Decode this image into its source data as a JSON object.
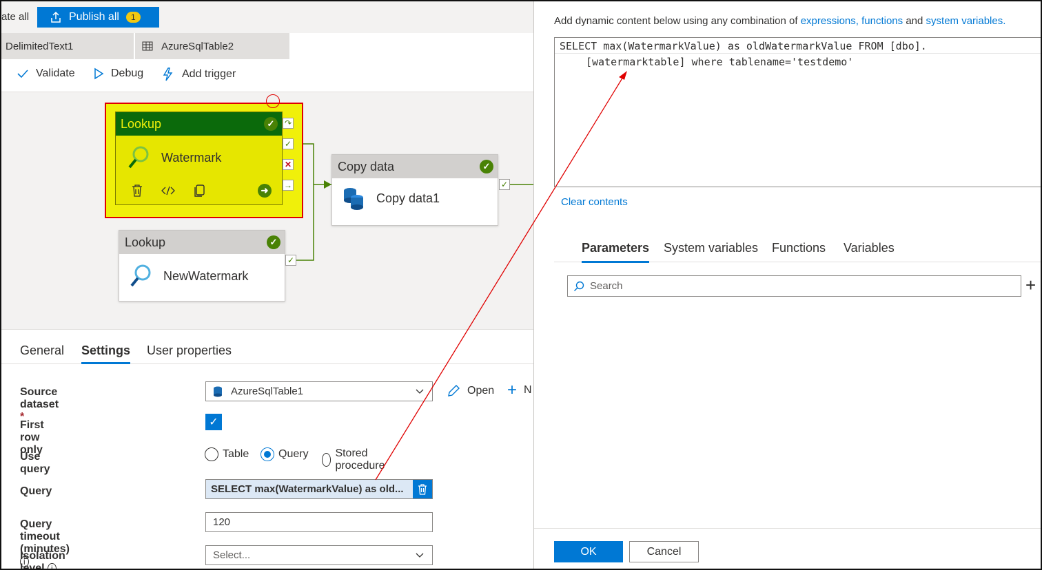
{
  "topbar": {
    "validate_all": "ate all",
    "publish_label": "Publish all",
    "publish_count": "1"
  },
  "tabs": [
    {
      "label": "DelimitedText1"
    },
    {
      "label": "AzureSqlTable2"
    }
  ],
  "toolbar": {
    "validate": "Validate",
    "debug": "Debug",
    "add_trigger": "Add trigger"
  },
  "pipeline": {
    "lookup_watermark": {
      "type": "Lookup",
      "name": "Watermark"
    },
    "lookup_new": {
      "type": "Lookup",
      "name": "NewWatermark"
    },
    "copy": {
      "type": "Copy data",
      "name": "Copy data1"
    }
  },
  "settings": {
    "tabs": [
      "General",
      "Settings",
      "User properties"
    ],
    "source_dataset_label": "Source dataset",
    "required_mark": "*",
    "source_dataset_value": "AzureSqlTable1",
    "open_label": "Open",
    "new_label": "N",
    "first_row_label": "First row only",
    "use_query_label": "Use query",
    "radio_table": "Table",
    "radio_query": "Query",
    "radio_stored": "Stored procedure",
    "query_label": "Query",
    "query_value": "SELECT max(WatermarkValue) as old...",
    "timeout_label": "Query timeout (minutes)",
    "timeout_value": "120",
    "isolation_label": "Isolation level",
    "isolation_placeholder": "Select..."
  },
  "dynamic": {
    "intro_text": "Add dynamic content below using any combination of ",
    "link_expr": "expressions,",
    "link_funcs": "functions",
    "and_text": " and ",
    "link_sysvars": "system variables.",
    "line1": "SELECT max(WatermarkValue) as oldWatermarkValue FROM [dbo].",
    "line2": "[watermarktable] where tablename='testdemo'",
    "clear": "Clear contents",
    "tabs": [
      "Parameters",
      "System variables",
      "Functions",
      "Variables"
    ],
    "search_placeholder": "Search",
    "ok": "OK",
    "cancel": "Cancel"
  },
  "colors": {
    "accent": "#0078d4",
    "highlight": "#f0f00a",
    "annotation": "#e00000",
    "success": "#498205"
  }
}
